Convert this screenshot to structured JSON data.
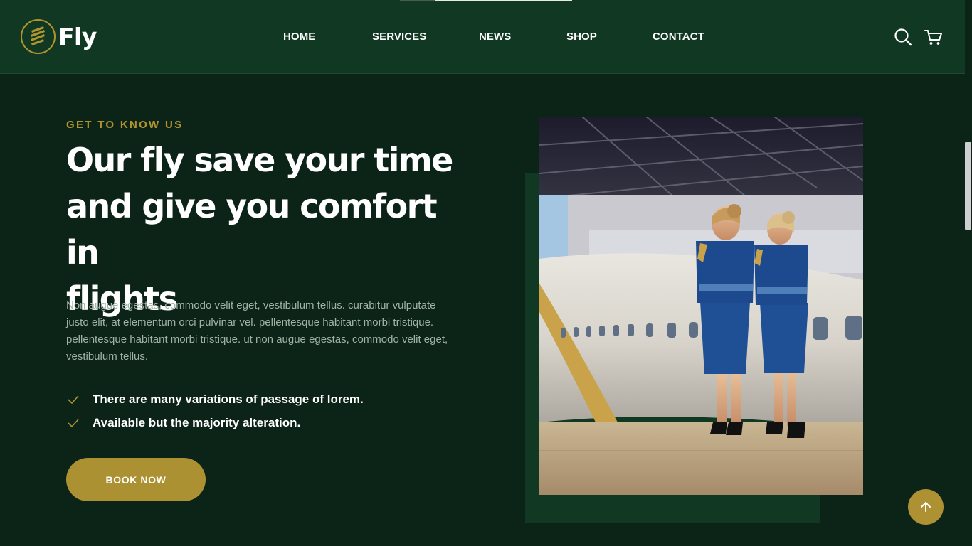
{
  "brand": {
    "name": "Fly",
    "accent": "#b0952f",
    "header_bg": "#113822",
    "page_bg": "#0c2317"
  },
  "nav": [
    {
      "label": "HOME"
    },
    {
      "label": "SERVICES"
    },
    {
      "label": "NEWS"
    },
    {
      "label": "SHOP"
    },
    {
      "label": "CONTACT"
    }
  ],
  "header_icons": [
    "search-icon",
    "cart-icon"
  ],
  "about": {
    "eyebrow": "GET TO KNOW US",
    "headline_lines": [
      "Our fly save your time",
      "and give you comfort in",
      "flights"
    ],
    "body": "Non augue egestas, commodo velit eget, vestibulum tellus. curabitur vulputate justo elit, at elementum orci pulvinar vel. pellentesque habitant morbi tristique. pellentesque habitant morbi tristique. ut non augue egestas, commodo velit eget, vestibulum tellus.",
    "features": [
      {
        "text": "There are many variations of passage of lorem."
      },
      {
        "text": "Available but the majority alteration."
      }
    ],
    "cta": "BOOK NOW"
  },
  "icons": {
    "check": "check-icon",
    "scroll_top": "arrow-up-icon"
  }
}
